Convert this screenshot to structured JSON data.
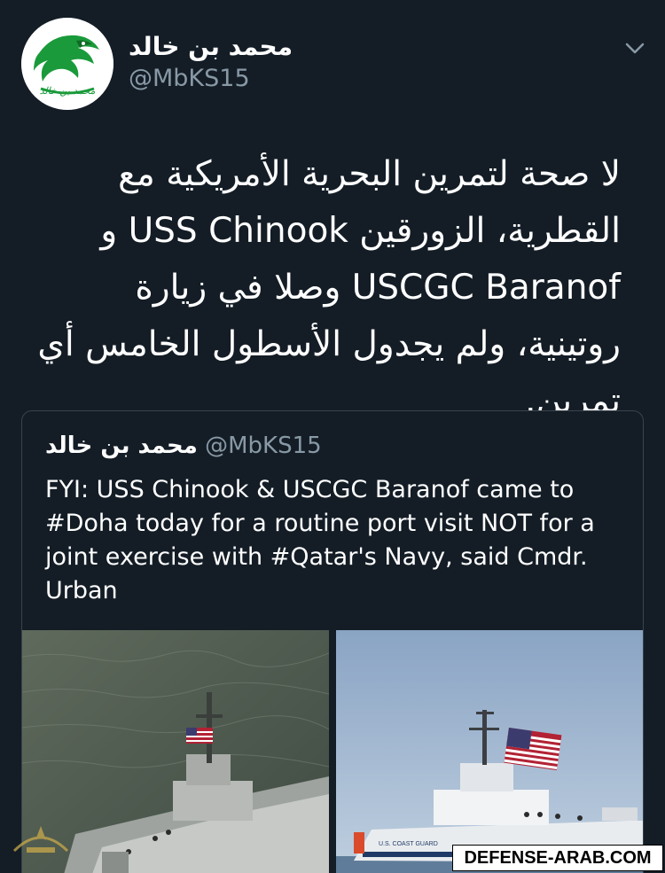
{
  "tweet": {
    "display_name": "محمد بن خالد",
    "handle": "@MbKS15",
    "avatar_icon": "eagle-logo-icon",
    "menu_icon": "chevron-down-icon",
    "text": "لا صحة لتمرين البحرية الأمريكية مع القطرية، الزورقين USS Chinook و USCGC Baranof وصلا في زيارة روتينية، ولم يجدول الأسطول الخامس أي تمرين."
  },
  "quoted_tweet": {
    "display_name": "محمد بن خالد",
    "handle": "@MbKS15",
    "text": "FYI: USS Chinook & USCGC Baranof came to #Doha today for a routine port visit NOT for a joint exercise with #Qatar's Navy, said Cmdr. Urban",
    "media": [
      {
        "icon": "patrol-boat-aerial-photo"
      },
      {
        "icon": "coast-guard-boat-flag-photo"
      }
    ]
  },
  "watermark": {
    "text": "DEFENSE-ARAB.COM"
  },
  "colors": {
    "background": "#141d26",
    "secondary_text": "#8899a6",
    "border": "#38444d",
    "brand_green": "#1a9a3a"
  }
}
